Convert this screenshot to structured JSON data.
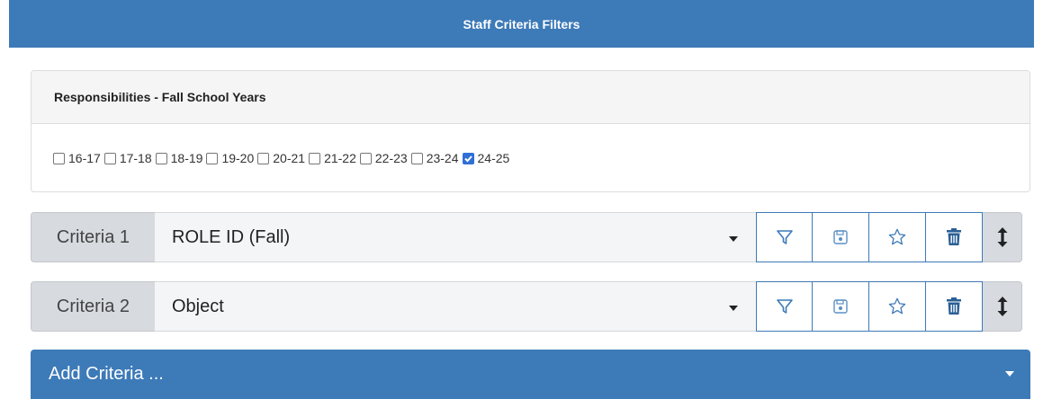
{
  "header": {
    "title": "Staff Criteria Filters"
  },
  "responsibilities": {
    "heading": "Responsibilities - Fall School Years",
    "years": [
      {
        "label": "16-17",
        "checked": false
      },
      {
        "label": "17-18",
        "checked": false
      },
      {
        "label": "18-19",
        "checked": false
      },
      {
        "label": "19-20",
        "checked": false
      },
      {
        "label": "20-21",
        "checked": false
      },
      {
        "label": "21-22",
        "checked": false
      },
      {
        "label": "22-23",
        "checked": false
      },
      {
        "label": "23-24",
        "checked": false
      },
      {
        "label": "24-25",
        "checked": true
      }
    ]
  },
  "criteria": [
    {
      "label": "Criteria 1",
      "value": "ROLE ID (Fall)"
    },
    {
      "label": "Criteria 2",
      "value": "Object"
    }
  ],
  "icons": [
    "filter-icon",
    "save-icon",
    "star-icon",
    "trash-icon",
    "vertical-arrows-icon"
  ],
  "add_criteria": {
    "label": "Add Criteria ..."
  },
  "colors": {
    "primary": "#3d7ab8",
    "checkbox_checked": "#2f6fd6",
    "label_bg": "#d7dbe0"
  }
}
